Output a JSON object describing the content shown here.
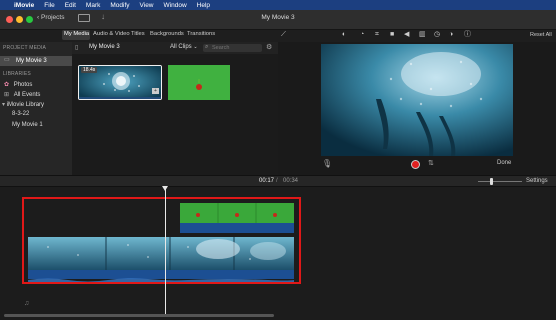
{
  "menubar": {
    "apple_glyph": "",
    "app_name": "iMovie",
    "items": [
      "File",
      "Edit",
      "Mark",
      "Modify",
      "View",
      "Window",
      "Help"
    ]
  },
  "toolbar": {
    "back_label": "Projects",
    "title": "My Movie 3"
  },
  "browser_tabs": [
    "My Media",
    "Audio & Video",
    "Titles",
    "Backgrounds",
    "Transitions"
  ],
  "sidebar": {
    "project_media_header": "PROJECT MEDIA",
    "project_item": "My Movie 3",
    "libraries_header": "LIBRARIES",
    "library_items": [
      "Photos",
      "All Events"
    ],
    "library_name": "iMovie Library",
    "events": [
      "8-3-22",
      "My Movie 1"
    ]
  },
  "browser": {
    "title": "My Movie 3",
    "filter": "All Clips",
    "search_placeholder": "Search",
    "clip1_duration": "18.4s"
  },
  "viewer": {
    "reset_all": "Reset All",
    "done": "Done"
  },
  "timeline": {
    "current_time": "00:17",
    "separator": "/",
    "total_time": "00:34",
    "settings": "Settings"
  },
  "colors": {
    "menubar": "#1c3f80",
    "selection_box": "#e01818",
    "record": "#e02020",
    "green_clip": "#3aa83a",
    "ocean_clip": "#2a6f8e"
  }
}
